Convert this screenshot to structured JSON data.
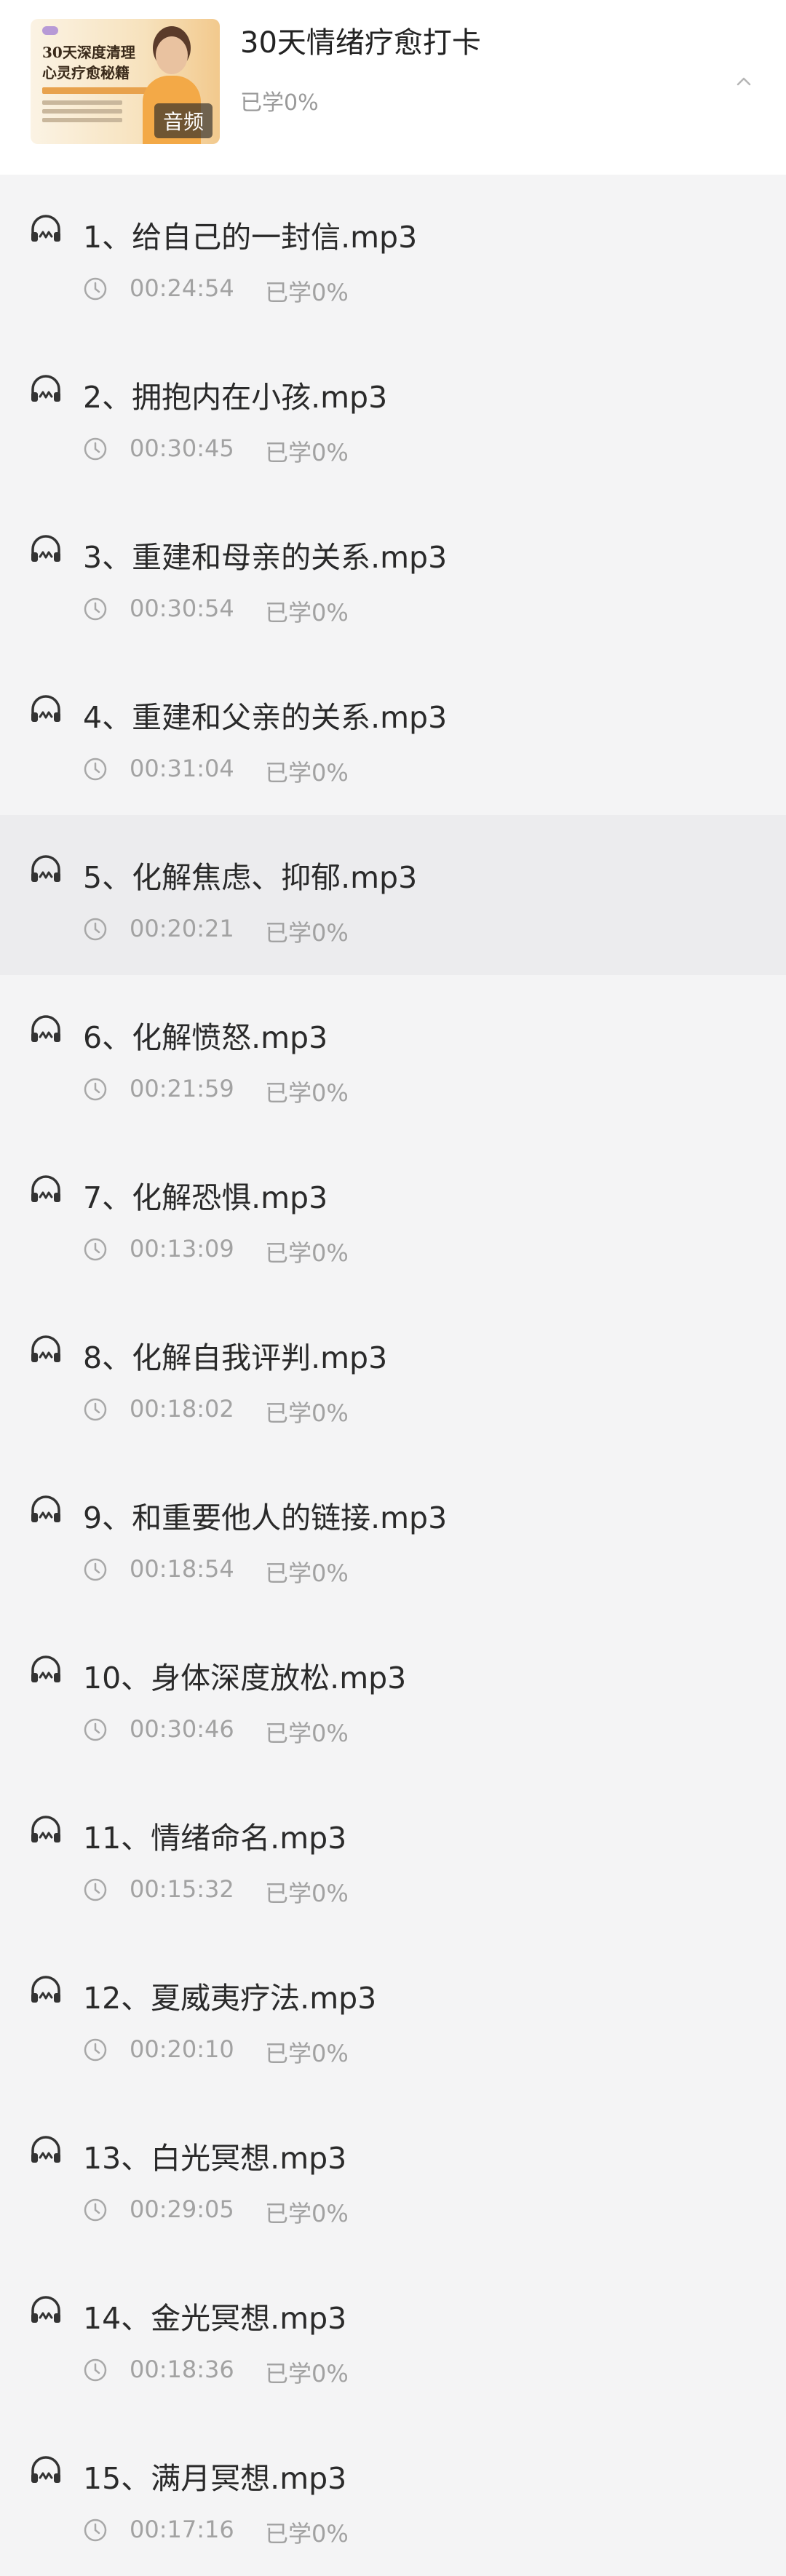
{
  "course": {
    "title": "30天情绪疗愈打卡",
    "progress": "已学0%",
    "cover_badge": "音频",
    "cover_title_lines": [
      "30天深度清理",
      "心灵疗愈秘籍"
    ]
  },
  "items": [
    {
      "title": "1、给自己的一封信.mp3",
      "duration": "00:24:54",
      "learned": "已学0%"
    },
    {
      "title": "2、拥抱内在小孩.mp3",
      "duration": "00:30:45",
      "learned": "已学0%"
    },
    {
      "title": "3、重建和母亲的关系.mp3",
      "duration": "00:30:54",
      "learned": "已学0%"
    },
    {
      "title": "4、重建和父亲的关系.mp3",
      "duration": "00:31:04",
      "learned": "已学0%"
    },
    {
      "title": "5、化解焦虑、抑郁.mp3",
      "duration": "00:20:21",
      "learned": "已学0%"
    },
    {
      "title": "6、化解愤怒.mp3",
      "duration": "00:21:59",
      "learned": "已学0%"
    },
    {
      "title": "7、化解恐惧.mp3",
      "duration": "00:13:09",
      "learned": "已学0%"
    },
    {
      "title": "8、化解自我评判.mp3",
      "duration": "00:18:02",
      "learned": "已学0%"
    },
    {
      "title": "9、和重要他人的链接.mp3",
      "duration": "00:18:54",
      "learned": "已学0%"
    },
    {
      "title": "10、身体深度放松.mp3",
      "duration": "00:30:46",
      "learned": "已学0%"
    },
    {
      "title": "11、情绪命名.mp3",
      "duration": "00:15:32",
      "learned": "已学0%"
    },
    {
      "title": "12、夏威夷疗法.mp3",
      "duration": "00:20:10",
      "learned": "已学0%"
    },
    {
      "title": "13、白光冥想.mp3",
      "duration": "00:29:05",
      "learned": "已学0%"
    },
    {
      "title": "14、金光冥想.mp3",
      "duration": "00:18:36",
      "learned": "已学0%"
    },
    {
      "title": "15、满月冥想.mp3",
      "duration": "00:17:16",
      "learned": "已学0%"
    }
  ],
  "icons": {
    "item_icon": "headphones-icon",
    "duration_icon": "clock-icon",
    "collapse_icon": "chevron-up-icon"
  },
  "colors": {
    "page_bg": "#f4f4f5",
    "header_bg": "#ffffff",
    "active_row_bg": "#ececee",
    "muted_text": "#a2a2a2"
  }
}
